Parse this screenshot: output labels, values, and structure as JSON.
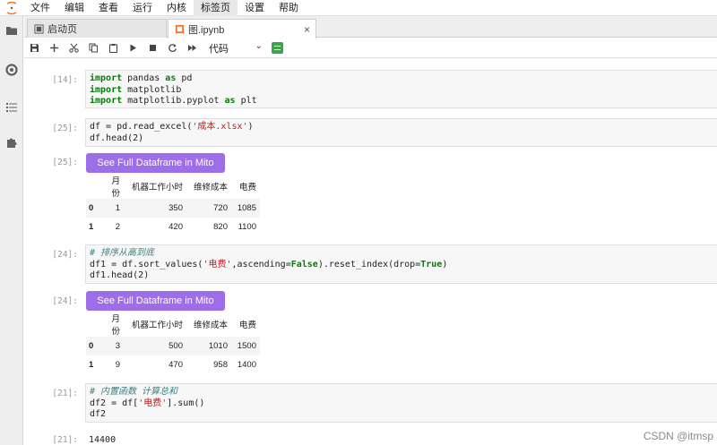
{
  "menu": [
    "文件",
    "编辑",
    "查看",
    "运行",
    "内核",
    "标签页",
    "设置",
    "帮助"
  ],
  "tabs": [
    {
      "label": "启动页"
    },
    {
      "label": "图.ipynb",
      "close": "×"
    }
  ],
  "toolbar": {
    "cell_type": "代码",
    "cell_type_arrow": "⌄"
  },
  "cells": {
    "c1": {
      "prompt": "[14]:"
    },
    "c2": {
      "prompt": "[25]:"
    },
    "o2": {
      "prompt": "[25]:",
      "mito_label": "See Full Dataframe in Mito",
      "columns": [
        "",
        "月份",
        "机器工作小时",
        "维修成本",
        "电费"
      ],
      "rows": [
        [
          "0",
          "1",
          "350",
          "720",
          "1085"
        ],
        [
          "1",
          "2",
          "420",
          "820",
          "1100"
        ]
      ]
    },
    "c3": {
      "prompt": "[24]:"
    },
    "o3": {
      "prompt": "[24]:",
      "mito_label": "See Full Dataframe in Mito",
      "columns": [
        "",
        "月份",
        "机器工作小时",
        "维修成本",
        "电费"
      ],
      "rows": [
        [
          "0",
          "3",
          "500",
          "1010",
          "1500"
        ],
        [
          "1",
          "9",
          "470",
          "958",
          "1400"
        ]
      ]
    },
    "c4": {
      "prompt": "[21]:"
    },
    "o4": {
      "prompt": "[21]:",
      "value": "14400"
    }
  },
  "code": {
    "l1_kw": "import",
    "l1_a": " pandas ",
    "l1_kw2": "as",
    "l1_b": " pd",
    "l2_kw": "import",
    "l2_a": " matplotlib",
    "l3_kw": "import",
    "l3_a": " matplotlib.pyplot ",
    "l3_kw2": "as",
    "l3_b": " plt",
    "c2_l1a": "df = pd.read_excel(",
    "c2_l1s": "'成本.xlsx'",
    "c2_l1b": ")",
    "c2_l2": "df.head(2)",
    "c3_l1": "# 排序从高到底",
    "c3_l2a": "df1 = df.sort_values(",
    "c3_l2s": "'电费'",
    "c3_l2b": ",ascending=",
    "c3_l2k": "False",
    "c3_l2c": ").reset_index(drop=",
    "c3_l2k2": "True",
    "c3_l2d": ")",
    "c3_l3": "df1.head(2)",
    "c4_l1": "# 内置函数 计算总和",
    "c4_l2a": "df2 = df[",
    "c4_l2s": "'电费'",
    "c4_l2b": "].sum()",
    "c4_l3": "df2"
  },
  "watermark": "CSDN @itmsp"
}
